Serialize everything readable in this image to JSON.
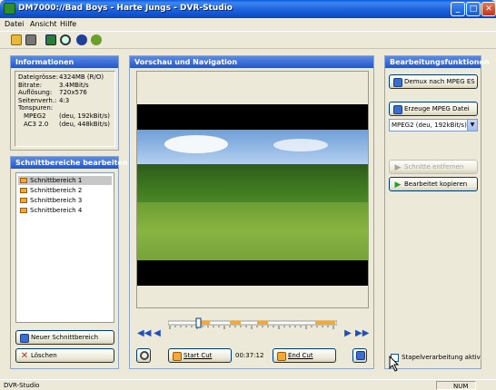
{
  "window": {
    "title": "DM7000://Bad Boys - Harte Jungs - DVR-Studio",
    "minimize": "_",
    "maximize": "□",
    "close": "✕"
  },
  "menu": [
    "Datei",
    "Ansicht",
    "Hilfe"
  ],
  "toolbar_icons": [
    "open-folder-icon",
    "drive-icon",
    "cut-mark-icon",
    "search-icon",
    "info-icon",
    "help-icon"
  ],
  "info": {
    "title": "Informationen",
    "rows": [
      {
        "label": "Dateigrösse:",
        "value": "4324MB (R/O)"
      },
      {
        "label": "Bitrate:",
        "value": "3.4MBit/s"
      },
      {
        "label": "Auflösung:",
        "value": "720x576"
      },
      {
        "label": "Seitenverh.:",
        "value": "4:3"
      }
    ],
    "tracks_label": "Tonspuren:",
    "tracks": [
      {
        "name": "MPEG2",
        "detail": "(deu, 192kBit/s)"
      },
      {
        "name": "AC3 2.0",
        "detail": "(deu, 448kBit/s)"
      }
    ]
  },
  "segments": {
    "title": "Schnittbereiche bearbeiten",
    "items": [
      "Schnittbereich 1",
      "Schnittbereich 2",
      "Schnittbereich 3",
      "Schnittbereich 4"
    ],
    "new_button": "Neuer Schnittbereich",
    "delete_button": "Löschen"
  },
  "preview": {
    "title": "Vorschau und Navigation",
    "start_cut": "Start Cut",
    "end_cut": "End Cut",
    "time": "00:37:12",
    "position_fraction": 0.17
  },
  "functions": {
    "title": "Bearbeitungsfunktionen",
    "demux": "Demux nach MPEG ES",
    "create_mpeg": "Erzeuge MPEG Datei",
    "audio_select": "MPEG2  (deu, 192kBit/s)",
    "remove_segments": "Schnitte entfernen",
    "copy_edited": "Bearbeitet kopieren",
    "batch_label": "Stapelverarbeitung aktiv"
  },
  "status": {
    "left": "DVR-Studio",
    "num": "NUM"
  },
  "colors": {
    "title_blue": "#0a58df",
    "panel_header": "#2457c5",
    "cut_marker": "#f2a93b"
  }
}
